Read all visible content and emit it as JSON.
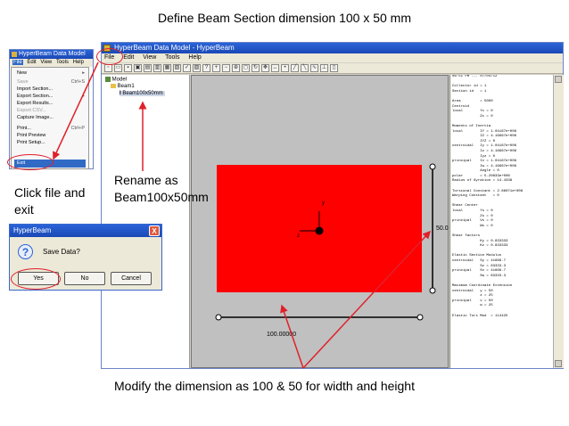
{
  "slide": {
    "heading": "Define Beam Section dimension 100 x 50 mm",
    "annotation_file": "Click file and exit",
    "annotation_rename": "Rename as Beam100x50mm",
    "annotation_modify": "Modify the dimension as 100 & 50 for width and height"
  },
  "main_window": {
    "title": "HyperBeam Data Model - HyperBeam",
    "menu": [
      "File",
      "Edit",
      "View",
      "Tools",
      "Help"
    ],
    "tree": {
      "root": "Model",
      "folder": "Beam1",
      "item": "Beam100x50mm"
    },
    "dimension_width": "100.00000",
    "dimension_height": "50.0",
    "axis_z": "z",
    "axis_y": "y",
    "results_lines": [
      "06:51 PM --- 07/04/12",
      "",
      "Collector id = 1",
      "Section id   = 1",
      "",
      "Area         = 5000",
      "Centroid",
      "local        Yc = 0",
      "             Zc = 0",
      "",
      "Moments of Inertia",
      "local        IY = 1.04167e+006",
      "             IZ = 4.16667e+006",
      "             IYZ = 0",
      "centroidal   Iy = 1.04167e+006",
      "             Iz = 4.16667e+006",
      "             Iyz = 0",
      "principal    Iv = 1.04167e+006",
      "             Iw = 4.16667e+006",
      "             Angle = 0",
      "polar        = 5.20833e+006",
      "Radius of Gyration = 14.4338",
      "",
      "Torsional Constant = 2.86071e+006",
      "Warping Constant   = 0",
      "",
      "Shear Center",
      "local        Ys = 0",
      "             Zs = 0",
      "principal    Vs = 0",
      "             Ws = 0",
      "",
      "Shear factors",
      "             Ky = 0.833333",
      "             Kz = 0.833333",
      "",
      "Elastic Section Modulus",
      "centroidal   Sy = 41666.7",
      "             Sz = 83333.3",
      "principal    Sv = 41666.7",
      "             Sw = 83333.3",
      "",
      "Maximum Coordinate Extension",
      "centroidal   y = 50",
      "             z = 25",
      "principal    v = 50",
      "             w = 25",
      "",
      "Elastic Tors Mod  = 114425"
    ]
  },
  "data_model_window": {
    "title": "HyperBeam Data Model",
    "menu": [
      "File",
      "Edit",
      "View",
      "Tools",
      "Help"
    ],
    "file_menu": {
      "new": "New",
      "save": "Save",
      "save_shortcut": "Ctrl+S",
      "import": "Import Section...",
      "export": "Export Section...",
      "export_results": "Export Results...",
      "export_csv": "Export CSV...",
      "capture": "Capture Image...",
      "print": "Print...",
      "print_shortcut": "Ctrl+P",
      "print_preview": "Print Preview",
      "print_setup": "Print Setup...",
      "exit": "Exit"
    }
  },
  "dialog": {
    "title": "HyperBeam",
    "message": "Save Data?",
    "yes": "Yes",
    "no": "No",
    "cancel": "Cancel",
    "close": "X"
  },
  "colors": {
    "section_fill": "#ff0000",
    "annotation": "#e0202a",
    "titlebar": "#2a63d8"
  }
}
